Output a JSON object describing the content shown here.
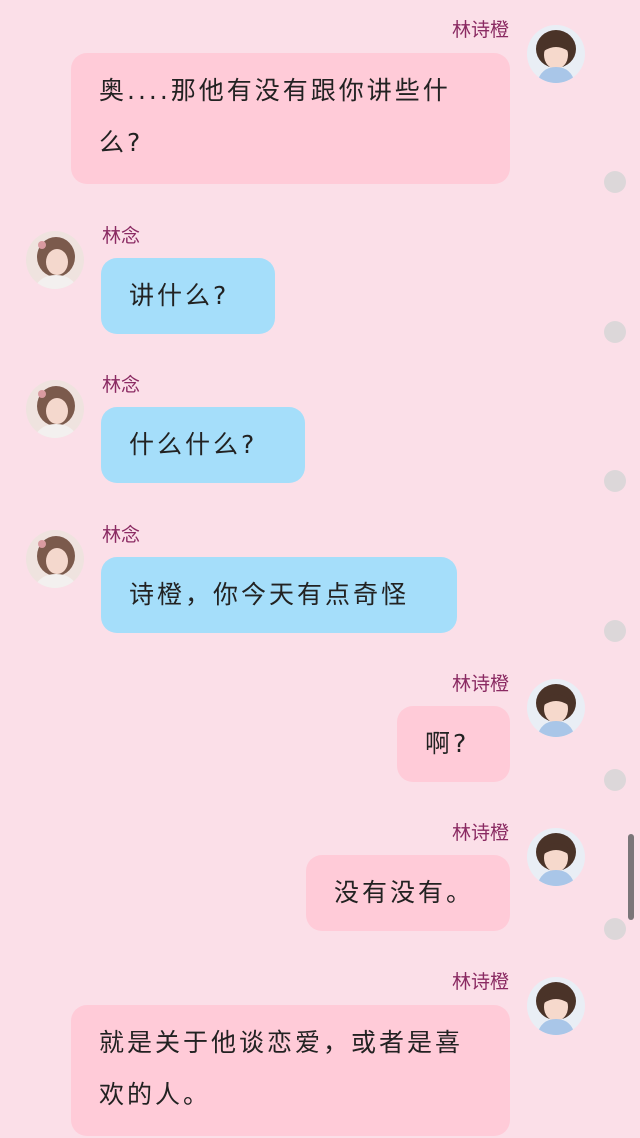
{
  "colors": {
    "background": "#fbdfe8",
    "bubble_self": "#ffcbd8",
    "bubble_other": "#a5defa",
    "name_text": "#8a2a62"
  },
  "messages": [
    {
      "side": "right",
      "name": "林诗橙",
      "text": "奥....那他有没有跟你讲些什么?",
      "avatar": "girl-avatar-icon"
    },
    {
      "side": "left",
      "name": "林念",
      "text": "讲什么?",
      "avatar": "woman-avatar-icon"
    },
    {
      "side": "left",
      "name": "林念",
      "text": "什么什么?",
      "avatar": "woman-avatar-icon"
    },
    {
      "side": "left",
      "name": "林念",
      "text": "诗橙，你今天有点奇怪",
      "avatar": "woman-avatar-icon"
    },
    {
      "side": "right",
      "name": "林诗橙",
      "text": "啊?",
      "avatar": "girl-avatar-icon"
    },
    {
      "side": "right",
      "name": "林诗橙",
      "text": "没有没有。",
      "avatar": "girl-avatar-icon"
    },
    {
      "side": "right",
      "name": "林诗橙",
      "text": "就是关于他谈恋爱，或者是喜欢的人。",
      "avatar": "girl-avatar-icon"
    }
  ]
}
